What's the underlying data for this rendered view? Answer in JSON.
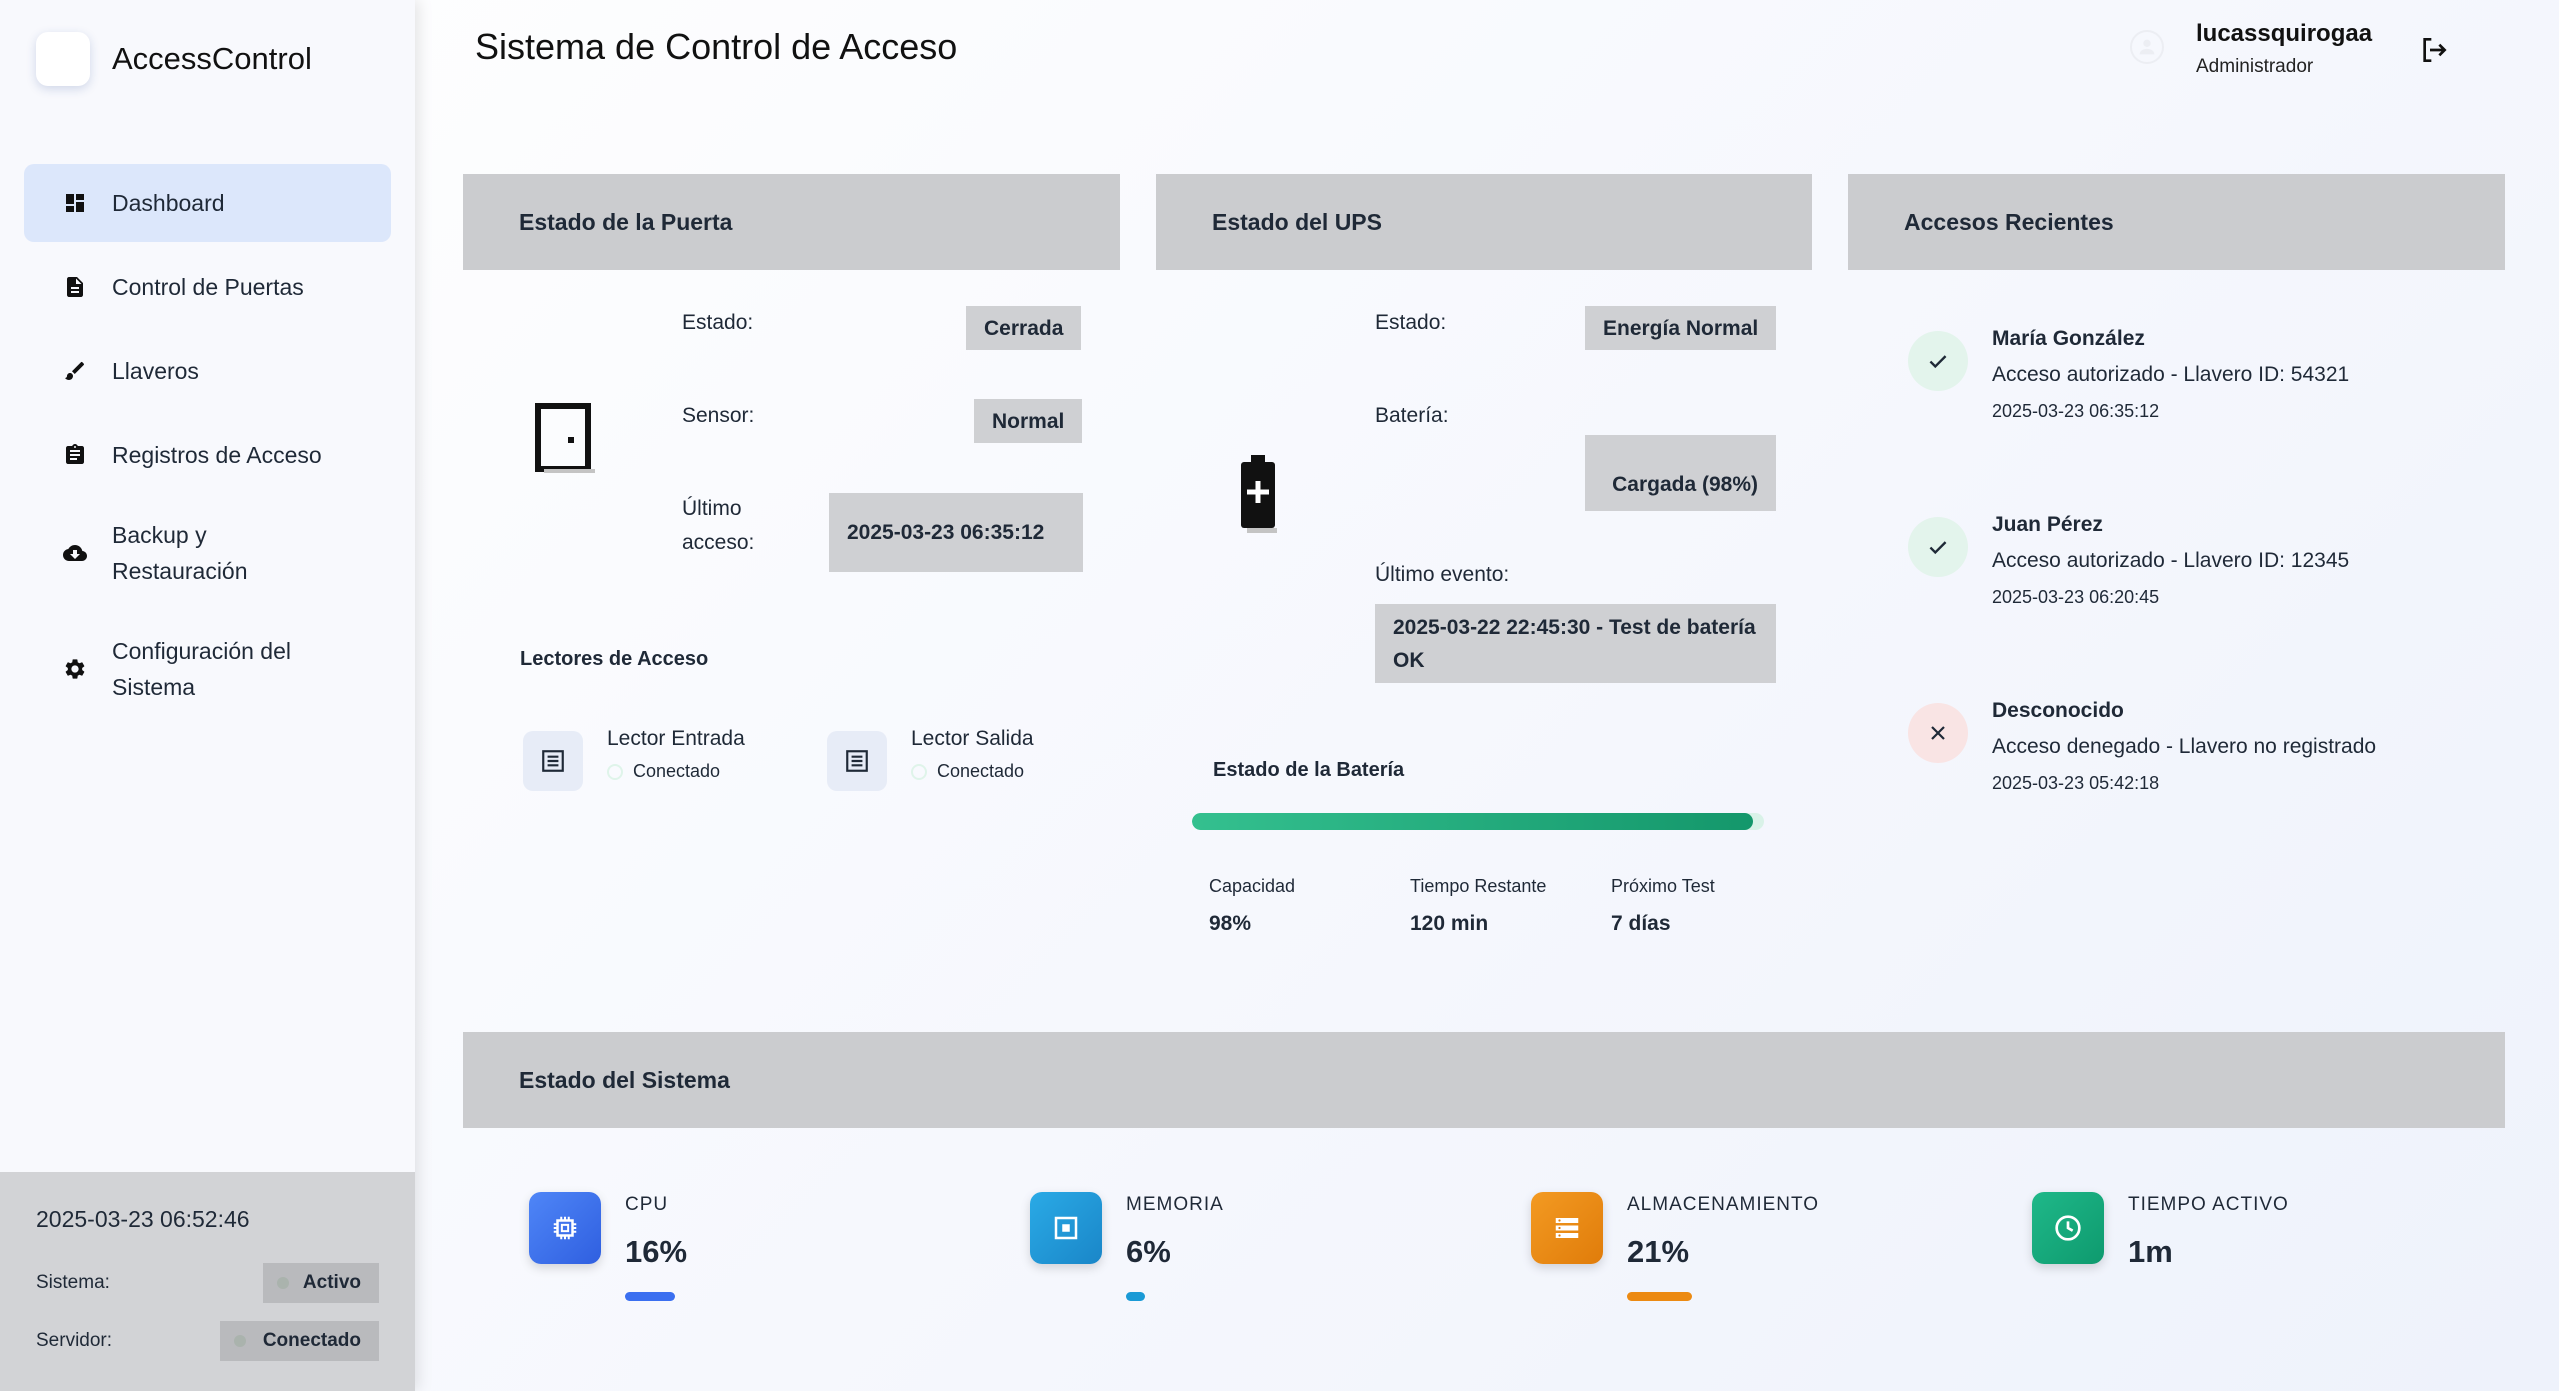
{
  "app": {
    "name": "AccessControl"
  },
  "sidebar": {
    "items": [
      {
        "label": "Dashboard",
        "icon": "dashboard-icon"
      },
      {
        "label": "Control de Puertas",
        "icon": "document-icon"
      },
      {
        "label": "Llaveros",
        "icon": "brush-icon"
      },
      {
        "label": "Registros de Acceso",
        "icon": "clipboard-icon"
      },
      {
        "label": "Backup y Restauración",
        "icon": "cloud-download-icon"
      },
      {
        "label": "Configuración del Sistema",
        "icon": "gear-icon"
      }
    ],
    "footer": {
      "datetime": "2025-03-23 06:52:46",
      "system_label": "Sistema:",
      "system_status": "Activo",
      "server_label": "Servidor:",
      "server_status": "Conectado"
    }
  },
  "header": {
    "title": "Sistema de Control de Acceso",
    "user": {
      "name": "lucassquirogaa",
      "role": "Administrador"
    }
  },
  "door": {
    "title": "Estado de la Puerta",
    "state_label": "Estado:",
    "state_value": "Cerrada",
    "sensor_label": "Sensor:",
    "sensor_value": "Normal",
    "last_label": "Último acceso:",
    "last_value": "2025-03-23 06:35:12",
    "readers_title": "Lectores de Acceso",
    "readers": [
      {
        "name": "Lector Entrada",
        "status": "Conectado"
      },
      {
        "name": "Lector Salida",
        "status": "Conectado"
      }
    ]
  },
  "ups": {
    "title": "Estado del UPS",
    "state_label": "Estado:",
    "state_value": "Energía Normal",
    "battery_label": "Batería:",
    "battery_value": "Cargada (98%)",
    "event_label": "Último evento:",
    "event_value": "2025-03-22 22:45:30 - Test de batería OK",
    "battery_section_title": "Estado de la Batería",
    "battery_level_percent": 98,
    "stats": [
      {
        "label": "Capacidad",
        "value": "98%"
      },
      {
        "label": "Tiempo Restante",
        "value": "120 min"
      },
      {
        "label": "Próximo Test",
        "value": "7 días"
      }
    ]
  },
  "recent": {
    "title": "Accesos Recientes",
    "items": [
      {
        "name": "María González",
        "desc": "Acceso autorizado - Llavero ID: 54321",
        "time": "2025-03-23 06:35:12",
        "status": "ok"
      },
      {
        "name": "Juan Pérez",
        "desc": "Acceso autorizado - Llavero ID: 12345",
        "time": "2025-03-23 06:20:45",
        "status": "ok"
      },
      {
        "name": "Desconocido",
        "desc": "Acceso denegado - Llavero no registrado",
        "time": "2025-03-23 05:42:18",
        "status": "denied"
      }
    ]
  },
  "system": {
    "title": "Estado del Sistema",
    "metrics": [
      {
        "label": "CPU",
        "value": "16%",
        "level_percent": 16,
        "color": "#3b6ff0",
        "icon": "cpu-icon"
      },
      {
        "label": "MEMORIA",
        "value": "6%",
        "level_percent": 6,
        "color": "#1a9ad6",
        "icon": "memory-icon"
      },
      {
        "label": "ALMACENAMIENTO",
        "value": "21%",
        "level_percent": 21,
        "color": "#ec8a12",
        "icon": "storage-icon"
      },
      {
        "label": "TIEMPO ACTIVO",
        "value": "1m",
        "color": "#13a77a",
        "icon": "clock-icon"
      }
    ]
  }
}
